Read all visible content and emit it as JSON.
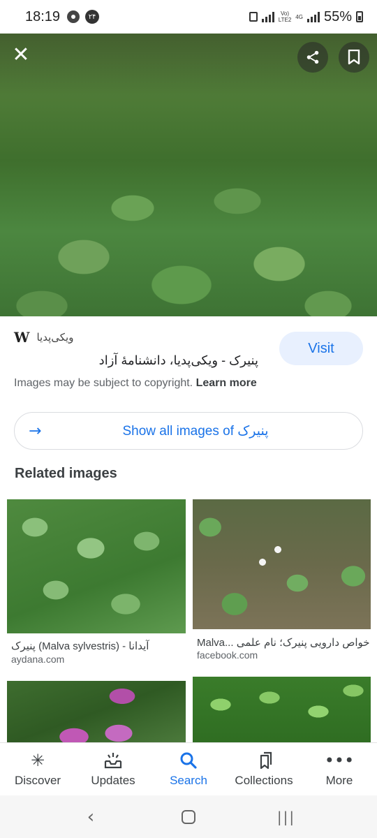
{
  "status_bar": {
    "time": "18:19",
    "notification_badge": "۲۴",
    "network_top": "Vo)",
    "network_bottom": "LTE2",
    "network2": "4G",
    "battery": "55%"
  },
  "hero": {
    "close_icon": "close-icon",
    "share_icon": "share-icon",
    "bookmark_icon": "bookmark-icon"
  },
  "result": {
    "source_logo": "W",
    "source_name": "ویکی‌پدیا",
    "title": "پنیرک - ویکی‌پدیا، دانشنامهٔ آزاد",
    "visit_label": "Visit",
    "copyright_text": "Images may be subject to copyright.",
    "learn_more": "Learn more"
  },
  "show_all": {
    "label": "Show all images of پنیرک"
  },
  "related": {
    "title": "Related images",
    "items": [
      {
        "caption": "پنیرک (Malva sylvestris) - آیدانا",
        "source": "aydana.com"
      },
      {
        "caption": "Malva... خواص دارویی پنیرک؛ نام علمی",
        "source": "facebook.com"
      }
    ]
  },
  "bottom_nav": [
    {
      "label": "Discover",
      "icon": "asterisk-icon"
    },
    {
      "label": "Updates",
      "icon": "updates-icon"
    },
    {
      "label": "Search",
      "icon": "search-icon"
    },
    {
      "label": "Collections",
      "icon": "collections-icon"
    },
    {
      "label": "More",
      "icon": "more-icon"
    }
  ],
  "colors": {
    "accent": "#1a73e8",
    "visit_bg": "#e8f0fe"
  }
}
